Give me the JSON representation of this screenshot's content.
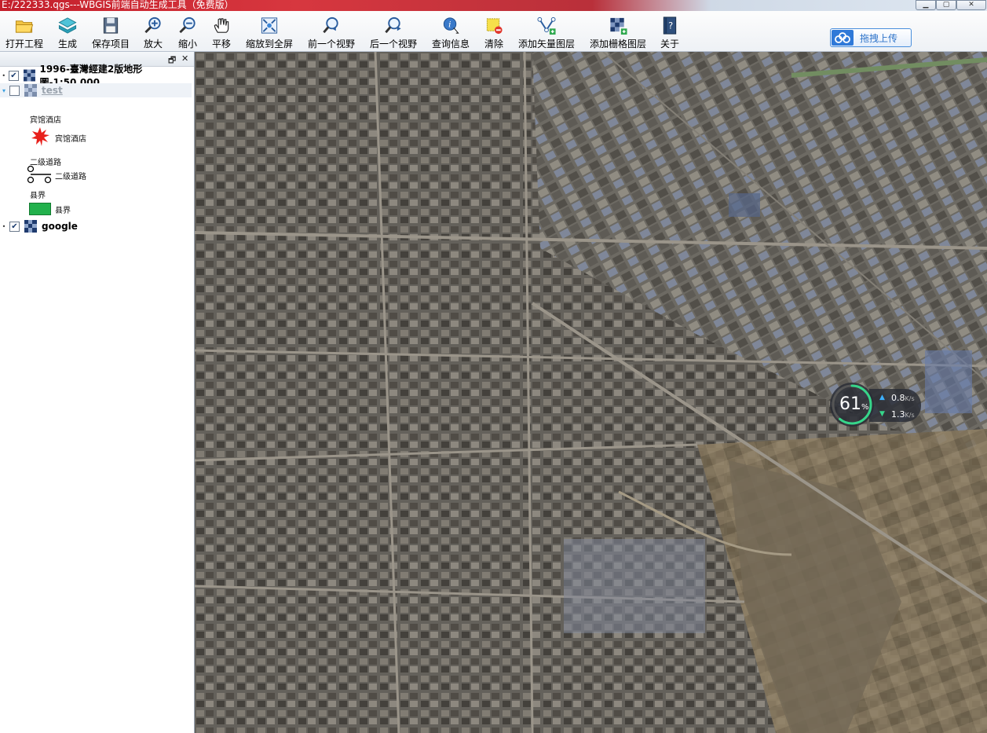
{
  "window": {
    "title": "E:/222333.qgs---WBGIS前端自动生成工具（免费版）",
    "controls": [
      "minimize",
      "maximize",
      "close"
    ]
  },
  "toolbar": {
    "buttons": [
      {
        "label": "打开工程",
        "icon": "folder-open-icon"
      },
      {
        "label": "生成",
        "icon": "layers-generate-icon"
      },
      {
        "label": "保存项目",
        "icon": "floppy-save-icon"
      },
      {
        "label": "放大",
        "icon": "zoom-in-icon"
      },
      {
        "label": "缩小",
        "icon": "zoom-out-icon"
      },
      {
        "label": "平移",
        "icon": "pan-hand-icon"
      },
      {
        "label": "缩放到全屏",
        "icon": "zoom-full-extent-icon"
      },
      {
        "label": "前一个视野",
        "icon": "zoom-previous-icon"
      },
      {
        "label": "后一个视野",
        "icon": "zoom-next-icon"
      },
      {
        "label": "查询信息",
        "icon": "identify-info-icon"
      },
      {
        "label": "清除",
        "icon": "clear-selection-icon"
      },
      {
        "label": "添加矢量图层",
        "icon": "add-vector-layer-icon"
      },
      {
        "label": "添加栅格图层",
        "icon": "add-raster-layer-icon"
      },
      {
        "label": "关于",
        "icon": "help-about-icon"
      }
    ],
    "upload_button": {
      "label": "拖拽上传",
      "icon": "cloud-upload-icon"
    }
  },
  "layers_panel": {
    "layers": [
      {
        "name": "1996-臺灣經建2版地形圖-1:50,000",
        "checked": true,
        "style": "bold"
      },
      {
        "name": "test",
        "checked": false,
        "style": "greyed"
      },
      {
        "name": "google",
        "checked": true,
        "style": "bold"
      }
    ],
    "legend": [
      {
        "group": "宾馆酒店",
        "item": "宾馆酒店",
        "symbol": "red-star-symbol-icon"
      },
      {
        "group": "二级道路",
        "item": "二级道路",
        "symbol": "road-line-symbol-icon"
      },
      {
        "group": "县界",
        "item": "县界",
        "symbol": "green-fill-symbol-icon",
        "color": "#22b14c"
      }
    ]
  },
  "network_monitor": {
    "percent": "61",
    "percent_unit": "%",
    "upload": "0.8",
    "download": "1.3",
    "unit": "K/s",
    "accent_up": "#3db0ff",
    "accent_down": "#36d68a",
    "gauge_fraction": 0.61
  }
}
